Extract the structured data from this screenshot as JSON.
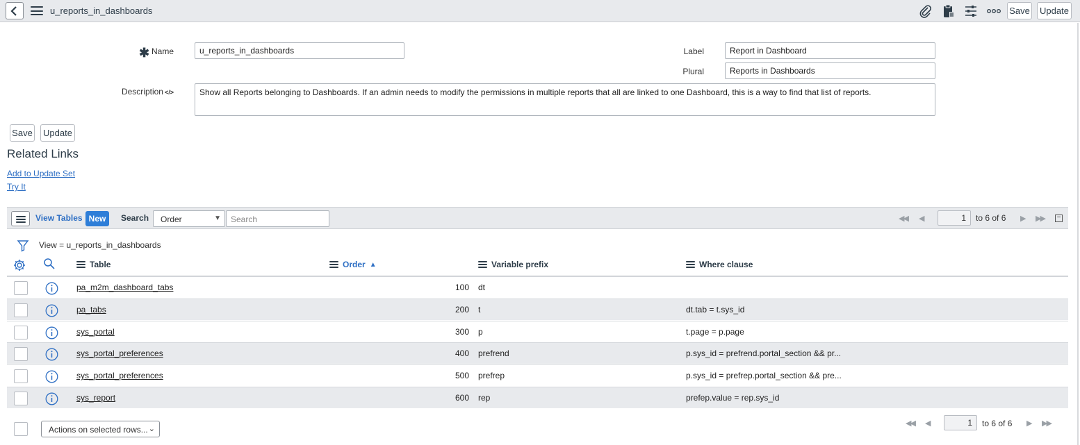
{
  "header": {
    "title": "u_reports_in_dashboards",
    "save_label": "Save",
    "update_label": "Update",
    "icons": [
      "back-icon",
      "menu-icon",
      "paperclip-icon",
      "clipboard-icon",
      "sliders-icon",
      "more-icon"
    ]
  },
  "form": {
    "name_label": "Name",
    "name_value": "u_reports_in_dashboards",
    "label_label": "Label",
    "label_value": "Report in Dashboard",
    "plural_label": "Plural",
    "plural_value": "Reports in Dashboards",
    "description_label": "Description",
    "description_icon": "</>",
    "description_value": "Show all Reports belonging to Dashboards. If an admin needs to modify the permissions in multiple reports that all are linked to one Dashboard, this is a way to find that list of reports.",
    "save_label": "Save",
    "update_label": "Update"
  },
  "related_links": {
    "title": "Related Links",
    "links": [
      "Add to Update Set",
      "Try It"
    ]
  },
  "list": {
    "title": "View Tables",
    "new_label": "New",
    "search_label": "Search",
    "search_field": "Order",
    "search_placeholder": "Search",
    "page_value": "1",
    "page_text": "to 6 of 6",
    "filter_text": "View = u_reports_in_dashboards",
    "columns": [
      "Table",
      "Order",
      "Variable prefix",
      "Where clause"
    ],
    "sort_column": "Order",
    "rows": [
      {
        "table": "pa_m2m_dashboard_tabs",
        "order": "100",
        "prefix": "dt",
        "where": ""
      },
      {
        "table": "pa_tabs",
        "order": "200",
        "prefix": "t",
        "where": "dt.tab = t.sys_id"
      },
      {
        "table": "sys_portal",
        "order": "300",
        "prefix": "p",
        "where": "t.page = p.page"
      },
      {
        "table": "sys_portal_preferences",
        "order": "400",
        "prefix": "prefrend",
        "where": "p.sys_id = prefrend.portal_section && pr..."
      },
      {
        "table": "sys_portal_preferences",
        "order": "500",
        "prefix": "prefrep",
        "where": "p.sys_id = prefrep.portal_section && pre..."
      },
      {
        "table": "sys_report",
        "order": "600",
        "prefix": "rep",
        "where": "prefep.value = rep.sys_id"
      }
    ],
    "actions_label": "Actions on selected rows...",
    "footer_page_value": "1",
    "footer_page_text": "to 6 of 6"
  },
  "colors": {
    "accent": "#2e6fc4",
    "new_button": "#2e7ed8",
    "header_bg": "#e8eaed"
  }
}
